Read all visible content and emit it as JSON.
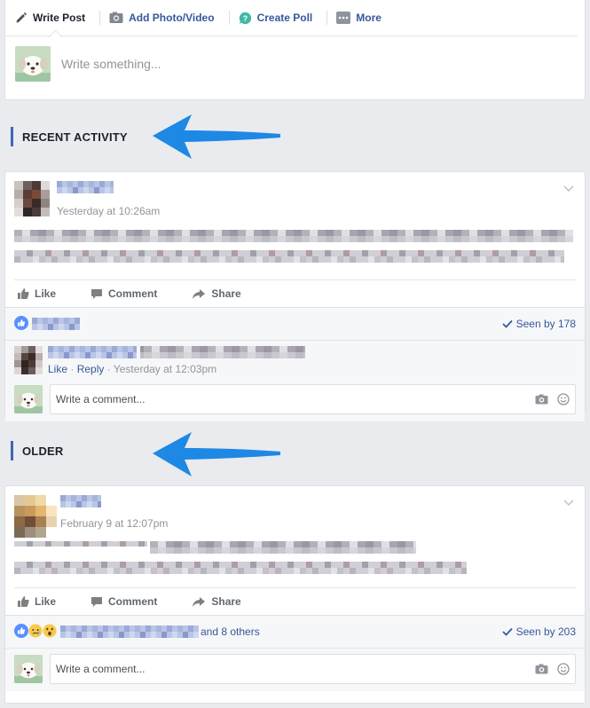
{
  "composer": {
    "tabs": [
      {
        "label": "Write Post",
        "icon": "pencil-icon"
      },
      {
        "label": "Add Photo/Video",
        "icon": "camera-icon"
      },
      {
        "label": "Create Poll",
        "icon": "poll-icon"
      },
      {
        "label": "More",
        "icon": "more-icon"
      }
    ],
    "placeholder": "Write something..."
  },
  "sections": {
    "recent": "RECENT ACTIVITY",
    "older": "OLDER"
  },
  "colors": {
    "accent": "#4267b2",
    "arrow": "#1e88e5",
    "link": "#365899"
  },
  "posts": [
    {
      "timestamp": "Yesterday at 10:26am",
      "actions": {
        "like": "Like",
        "comment": "Comment",
        "share": "Share"
      },
      "seen": "Seen by 178",
      "comment": {
        "like": "Like",
        "dot": "·",
        "reply": "Reply",
        "time": "Yesterday at 12:03pm"
      },
      "write_placeholder": "Write a comment..."
    },
    {
      "timestamp": "February 9 at 12:07pm",
      "actions": {
        "like": "Like",
        "comment": "Comment",
        "share": "Share"
      },
      "reactions_others": "and 8 others",
      "seen": "Seen by 203",
      "write_placeholder": "Write a comment..."
    }
  ]
}
